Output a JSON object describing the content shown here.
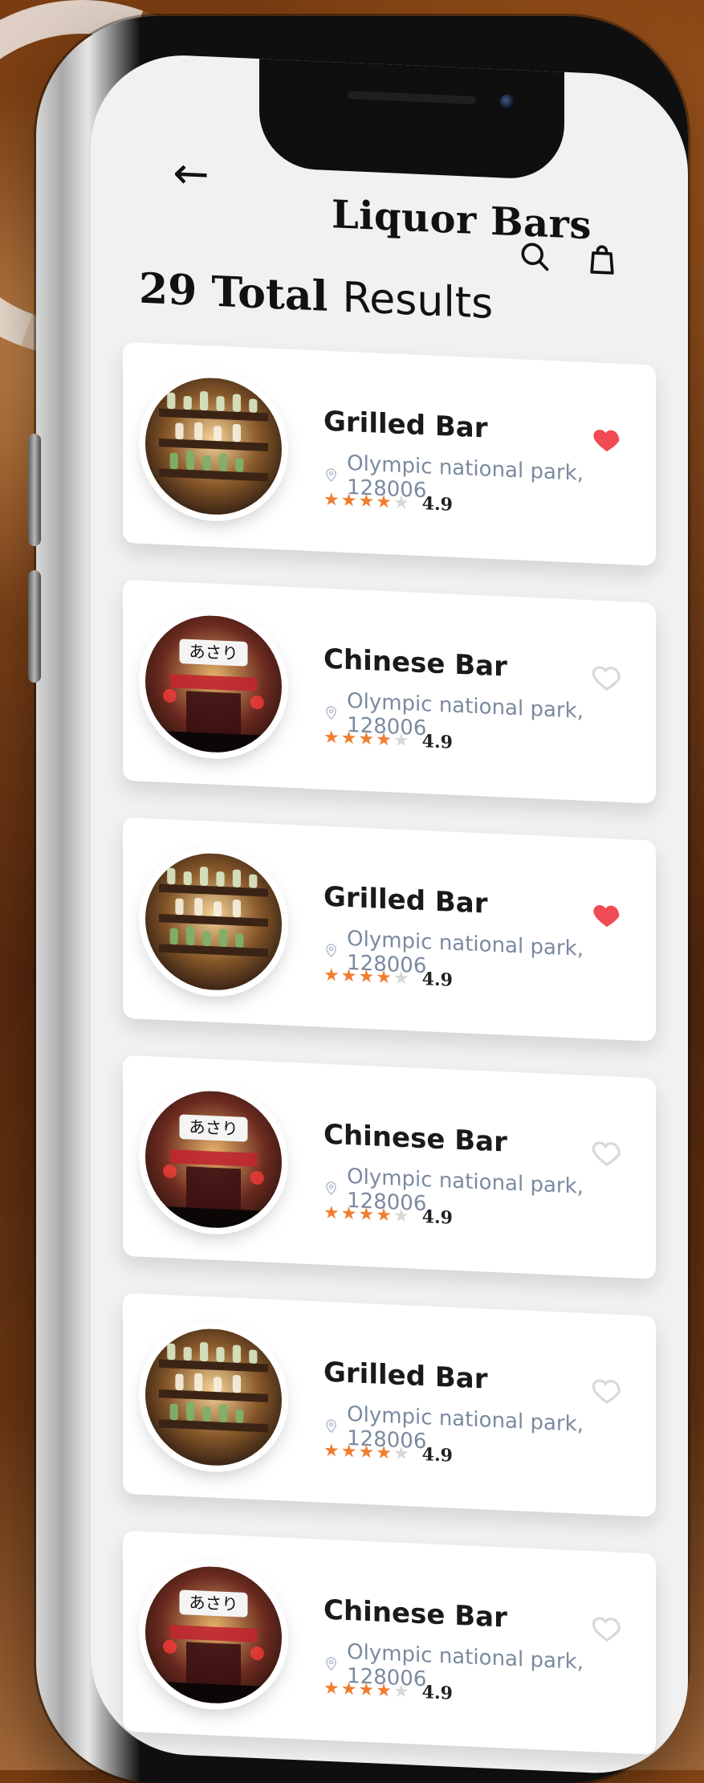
{
  "app": {
    "title": "Liquor Bars"
  },
  "header": {
    "back_icon": "arrow-left-icon",
    "search_icon": "search-icon",
    "bag_icon": "shopping-bag-icon"
  },
  "results": {
    "count": "29",
    "label_part1": "Total",
    "label_part2": "Results"
  },
  "colors": {
    "accent_star": "#f07d2f",
    "accent_heart": "#f04a55"
  },
  "items": [
    {
      "name": "Grilled Bar",
      "location": "Olympic national park, 128006",
      "rating": "4.9",
      "favorite": true,
      "image_icon": "bar-shelves-image"
    },
    {
      "name": "Chinese Bar",
      "location": "Olympic national park, 128006",
      "rating": "4.9",
      "favorite": false,
      "image_icon": "neon-bar-image"
    },
    {
      "name": "Grilled Bar",
      "location": "Olympic national park, 128006",
      "rating": "4.9",
      "favorite": true,
      "image_icon": "bar-shelves-image"
    },
    {
      "name": "Chinese Bar",
      "location": "Olympic national park, 128006",
      "rating": "4.9",
      "favorite": false,
      "image_icon": "neon-bar-image"
    },
    {
      "name": "Grilled Bar",
      "location": "Olympic national park, 128006",
      "rating": "4.9",
      "favorite": false,
      "image_icon": "bar-shelves-image"
    },
    {
      "name": "Chinese Bar",
      "location": "Olympic national park, 128006",
      "rating": "4.9",
      "favorite": false,
      "image_icon": "neon-bar-image"
    }
  ]
}
